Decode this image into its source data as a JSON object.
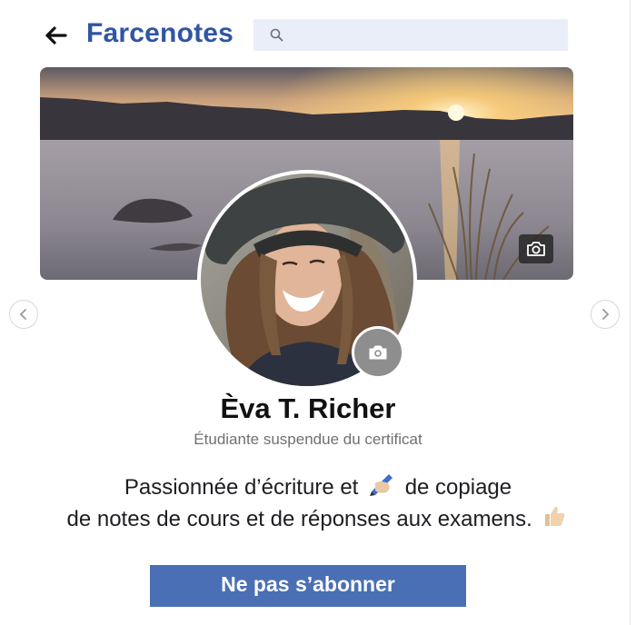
{
  "header": {
    "brand": "Farcenotes",
    "search_placeholder": ""
  },
  "profile": {
    "name": "Èva T. Richer",
    "subtitle": "Étudiante suspendue du certificat",
    "bio_line1_before": "Passionnée d’écriture et",
    "bio_line1_after": "de copiage",
    "bio_line2": "de notes de cours et de réponses aux examens.",
    "follow_button": "Ne pas s’abonner"
  },
  "icons": {
    "back": "arrow-left-icon",
    "search": "magnifier-icon",
    "cover_camera": "camera-icon",
    "avatar_camera": "camera-icon",
    "bio_emoji_1": "writing-hand-emoji",
    "bio_emoji_2": "thumbs-up-emoji",
    "prev": "chevron-left-icon",
    "next": "chevron-right-icon"
  },
  "colors": {
    "brand": "#2f55a4",
    "search_bg": "#e9eef8",
    "button_bg": "#4a6fb5",
    "subtitle": "#707070"
  }
}
